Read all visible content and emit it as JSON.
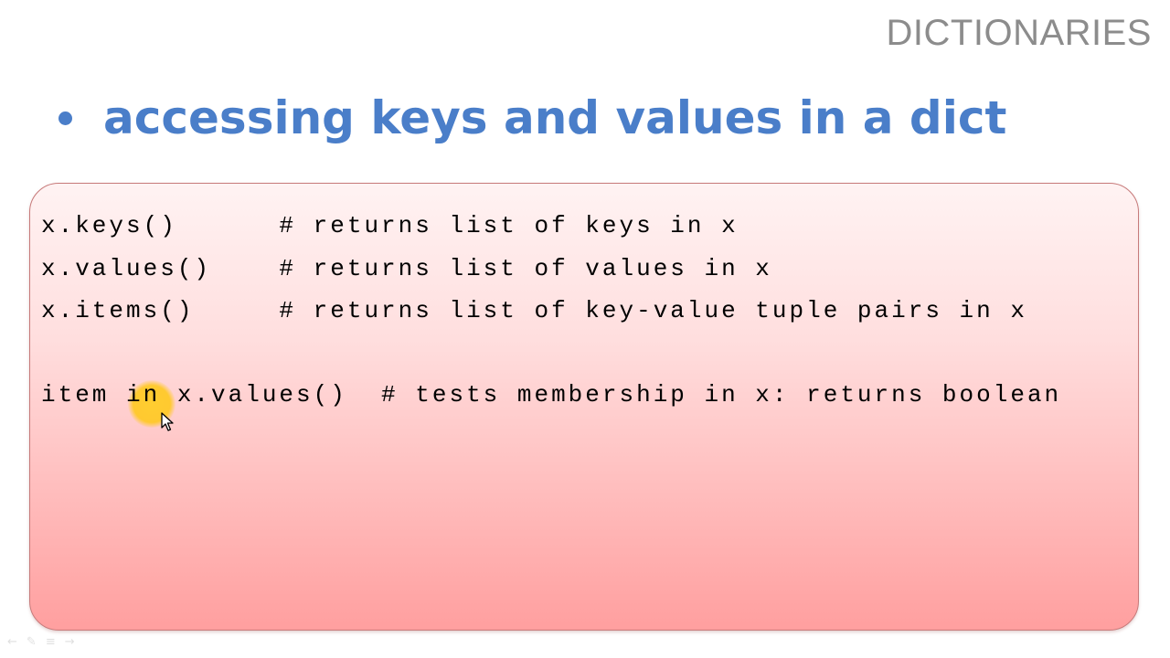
{
  "slide": {
    "section_title": "DICTIONARIES",
    "bullet": "accessing keys and values in a dict"
  },
  "code": {
    "lines": [
      "x.keys()      # returns list of keys in x",
      "x.values()    # returns list of values in x",
      "x.items()     # returns list of key-value tuple pairs in x",
      "item in x.values()  # tests membership in x: returns boolean"
    ]
  },
  "colors": {
    "bullet_blue": "#4a7ec9",
    "title_gray": "#8c8c8c",
    "box_border": "#c77a7a",
    "highlight_yellow": "#ffcd28"
  },
  "icons": {
    "cursor": "mouse-pointer-icon",
    "highlight": "cursor-highlight-icon",
    "prev": "back-arrow-icon",
    "pen": "pen-icon",
    "menu": "menu-icon",
    "next": "forward-arrow-icon"
  }
}
